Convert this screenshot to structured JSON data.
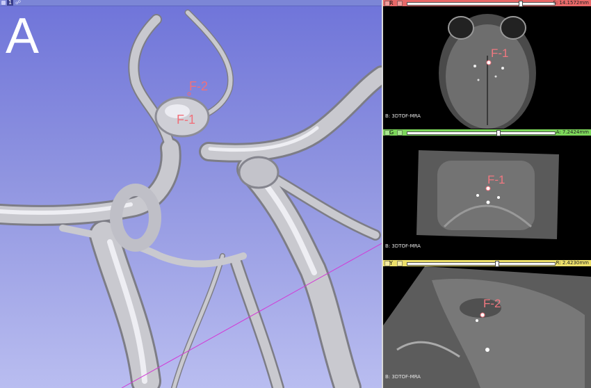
{
  "view3d": {
    "view_number": "1",
    "panel_letter": "A",
    "fiducials": [
      {
        "label": "F-2"
      },
      {
        "label": "F-1"
      }
    ]
  },
  "slices": {
    "red": {
      "tag": "R",
      "offset_label": "S: 14.1572mm",
      "slider_fraction": 0.77,
      "volume_label": "B: 3DTOF-MRA",
      "fiducial": "F-1",
      "color": "#e86969"
    },
    "green": {
      "tag": "G",
      "offset_label": "A: 7.2424mm",
      "slider_fraction": 0.62,
      "volume_label": "B: 3DTOF-MRA",
      "fiducial": "F-1",
      "color": "#7cd65a"
    },
    "yellow": {
      "tag": "Y",
      "offset_label": "R: 2.4230mm",
      "slider_fraction": 0.61,
      "volume_label": "B: 3DTOF-MRA",
      "fiducial": "F-2",
      "color": "#ecdf6a"
    }
  }
}
